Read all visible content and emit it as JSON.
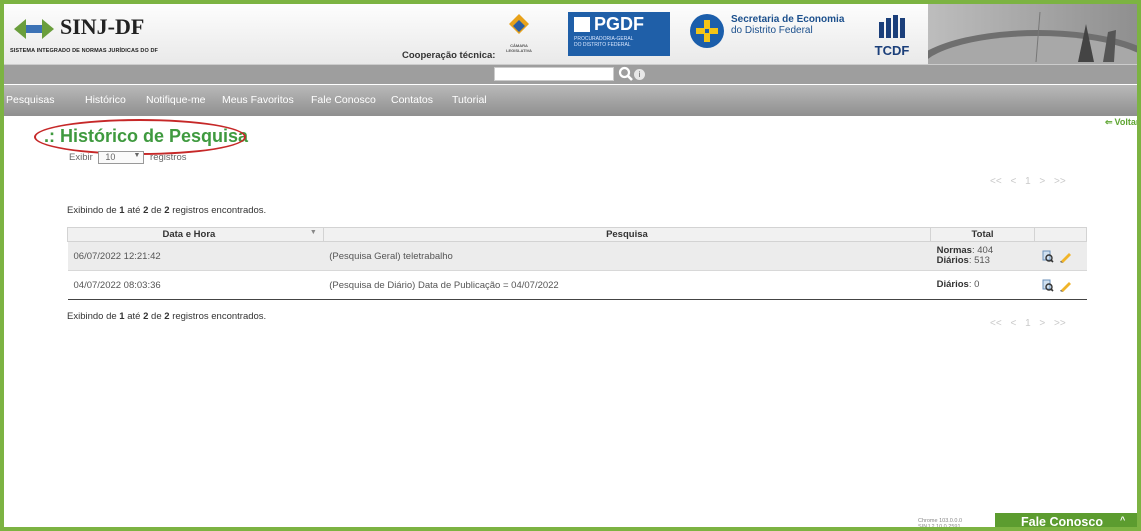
{
  "header": {
    "logo_title": "SINJ-DF",
    "logo_subtitle": "SISTEMA INTEGRADO DE NORMAS JURÍDICAS DO DF",
    "cooperacao": "Cooperação técnica:",
    "camara_label": "CÂMARA LEGISLATIVA",
    "pgdf_title": "PGDF",
    "pgdf_sub1": "PROCURADORIA-GERAL",
    "pgdf_sub2": "DO DISTRITO FEDERAL",
    "seco_line1": "Secretaria de Economia",
    "seco_line2": "do Distrito Federal",
    "tcdf_label": "TCDF"
  },
  "search": {
    "placeholder": "",
    "info": "i"
  },
  "nav": {
    "items": [
      "Pesquisas",
      "Histórico",
      "Notifique-me",
      "Meus Favoritos",
      "Fale Conosco",
      "Contatos",
      "Tutorial"
    ]
  },
  "page": {
    "voltar": "Voltar",
    "title": ".: Histórico de Pesquisa",
    "exibir_label": "Exibir",
    "exibir_value": "10",
    "registros_label": "registros",
    "pager": "<< < 1 > >>",
    "count": {
      "prefix": "Exibindo de",
      "from": "1",
      "to_label": "até",
      "to": "2",
      "of_label": "de",
      "total": "2",
      "suffix": "registros encontrados."
    }
  },
  "table": {
    "headers": {
      "date": "Data e Hora",
      "search": "Pesquisa",
      "total": "Total"
    },
    "rows": [
      {
        "date": "06/07/2022 12:21:42",
        "search": "(Pesquisa Geral) teletrabalho",
        "normas_label": "Normas",
        "normas": ": 404",
        "diarios_label": "Diários",
        "diarios": ": 513"
      },
      {
        "date": "04/07/2022 08:03:36",
        "search": "(Pesquisa de Diário) Data de Publicação = 04/07/2022",
        "diarios_label": "Diários",
        "diarios": ": 0"
      }
    ]
  },
  "footer": {
    "chrome_line1": "Chrome 103.0.0.0",
    "chrome_line2": "SINJ 2.10.0.2591",
    "fale": "Fale Conosco",
    "caret": "^"
  },
  "colors": {
    "accent_green": "#3f9a3f",
    "nav_gray": "#9e9e9e",
    "footer_green": "#5c9c2f",
    "annotation_red": "#c62828"
  }
}
